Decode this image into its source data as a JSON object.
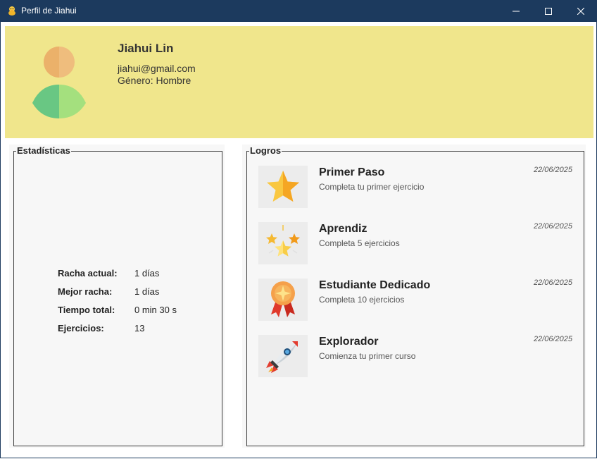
{
  "window": {
    "title": "Perfil de Jiahui",
    "accent": "#1c3a5e"
  },
  "profile": {
    "name": "Jiahui Lin",
    "email": "jiahui@gmail.com",
    "gender": "Género: Hombre",
    "header_color": "#f0e68c",
    "avatar_icon": "user-avatar-icon"
  },
  "stats": {
    "legend": "Estadísticas",
    "rows": [
      {
        "label": "Racha actual:",
        "value": "1 días"
      },
      {
        "label": "Mejor racha:",
        "value": "1 días"
      },
      {
        "label": "Tiempo total:",
        "value": "0 min 30 s"
      },
      {
        "label": "Ejercicios:",
        "value": "13"
      }
    ]
  },
  "achievements": {
    "legend": "Logros",
    "items": [
      {
        "title": "Primer Paso",
        "description": "Completa tu primer ejercicio",
        "date": "22/06/2025",
        "icon": "star-icon"
      },
      {
        "title": "Aprendiz",
        "description": "Completa 5 ejercicios",
        "date": "22/06/2025",
        "icon": "stars-icon"
      },
      {
        "title": "Estudiante Dedicado",
        "description": "Completa 10 ejercicios",
        "date": "22/06/2025",
        "icon": "medal-icon"
      },
      {
        "title": "Explorador",
        "description": "Comienza tu primer curso",
        "date": "22/06/2025",
        "icon": "rocket-icon"
      }
    ]
  }
}
